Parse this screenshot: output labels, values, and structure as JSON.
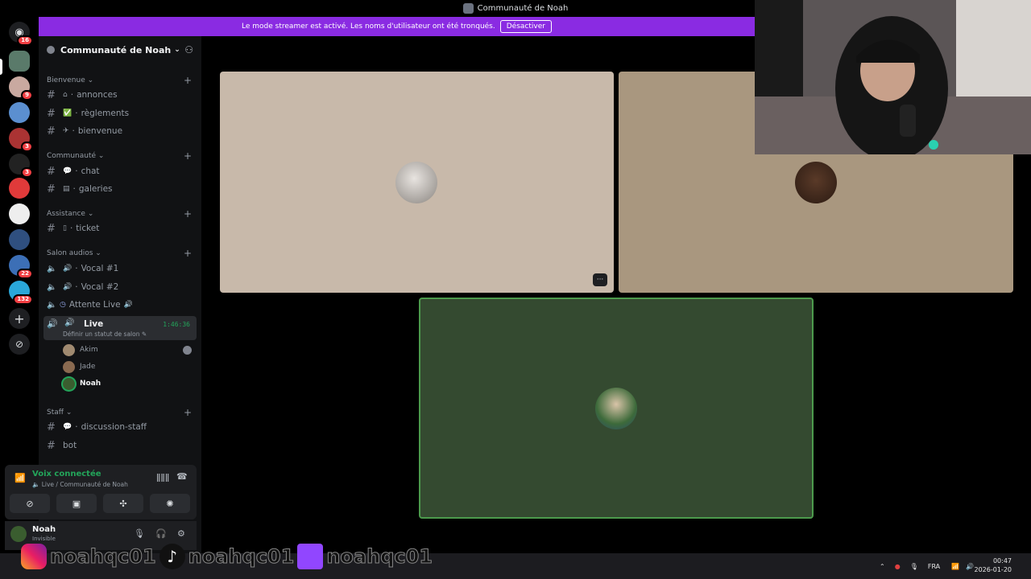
{
  "window": {
    "title": "Communauté de Noah"
  },
  "banner": {
    "text": "Le mode streamer est activé. Les noms d'utilisateur ont été tronqués.",
    "button": "Désactiver"
  },
  "rail": {
    "badges": [
      "16",
      "9",
      "3",
      "3",
      "22",
      "132"
    ]
  },
  "server": {
    "name": "Communauté de Noah"
  },
  "categories": [
    {
      "label": "Bienvenue"
    },
    {
      "label": "Communauté"
    },
    {
      "label": "Assistance"
    },
    {
      "label": "Salon audios"
    },
    {
      "label": "Staff"
    }
  ],
  "channels": {
    "annonces": "annonces",
    "reglements": "règlements",
    "bienvenue": "bienvenue",
    "chat": "chat",
    "galeries": "galeries",
    "ticket": "ticket",
    "vocal1": "Vocal #1",
    "vocal2": "Vocal #2",
    "attente": "Attente Live",
    "live": "Live",
    "discussion_staff": "discussion-staff",
    "bot": "bot"
  },
  "live_channel": {
    "timer": "1:46:36",
    "status_placeholder": "Définir un statut de salon"
  },
  "members": [
    "Akim",
    "Jade",
    "Noah"
  ],
  "voice": {
    "title": "Voix connectée",
    "subtitle": "Live / Communauté de Noah"
  },
  "user": {
    "name": "Noah",
    "status": "Invisible"
  },
  "overlay": {
    "instagram": "noahqc01",
    "tiktok": "noahqc01",
    "twitch": "noahqc01"
  },
  "tray": {
    "lang": "FRA",
    "time": "00:47",
    "date": "2026-01-20"
  },
  "colors": {
    "accent": "#8a2be2",
    "online": "#23a55a",
    "tile1": "#c8b9aa",
    "tile2": "#a9977f",
    "tile3": "#344a30"
  }
}
